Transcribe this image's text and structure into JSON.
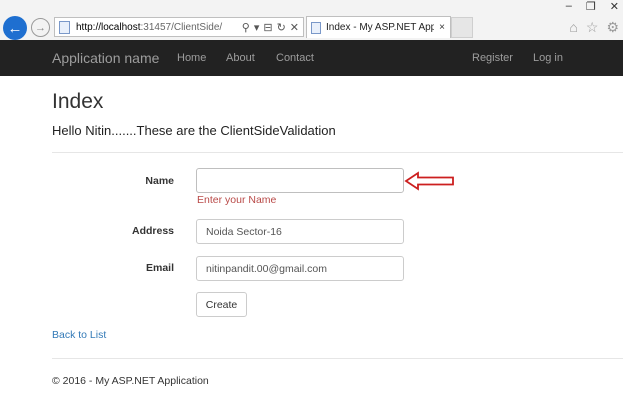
{
  "browser": {
    "window_controls": [
      "–",
      "❐",
      "✕"
    ],
    "url_host": "http://localhost",
    "url_path": ":31457/ClientSide/",
    "tab_title": "Index - My ASP.NET Applic...",
    "tab_close": "×",
    "toolbar_icons": [
      "home-icon",
      "star-icon",
      "gear-icon"
    ]
  },
  "navbar": {
    "brand": "Application name",
    "links": [
      "Home",
      "About",
      "Contact"
    ],
    "right_links": [
      "Register",
      "Log in"
    ]
  },
  "page": {
    "title": "Index",
    "subtitle": "Hello Nitin.......These are the ClientSideValidation"
  },
  "form": {
    "name_label": "Name",
    "name_value": "",
    "name_error": "Enter your Name",
    "address_label": "Address",
    "address_value": "Noida Sector-16",
    "email_label": "Email",
    "email_value": "nitinpandit.00@gmail.com",
    "submit_label": "Create"
  },
  "back_link": "Back to List",
  "footer": "© 2016 - My ASP.NET Application",
  "colors": {
    "navbar_bg": "#222222",
    "link": "#337ab7",
    "error": "#b94a48",
    "annotation_arrow": "#cc1f1f"
  }
}
